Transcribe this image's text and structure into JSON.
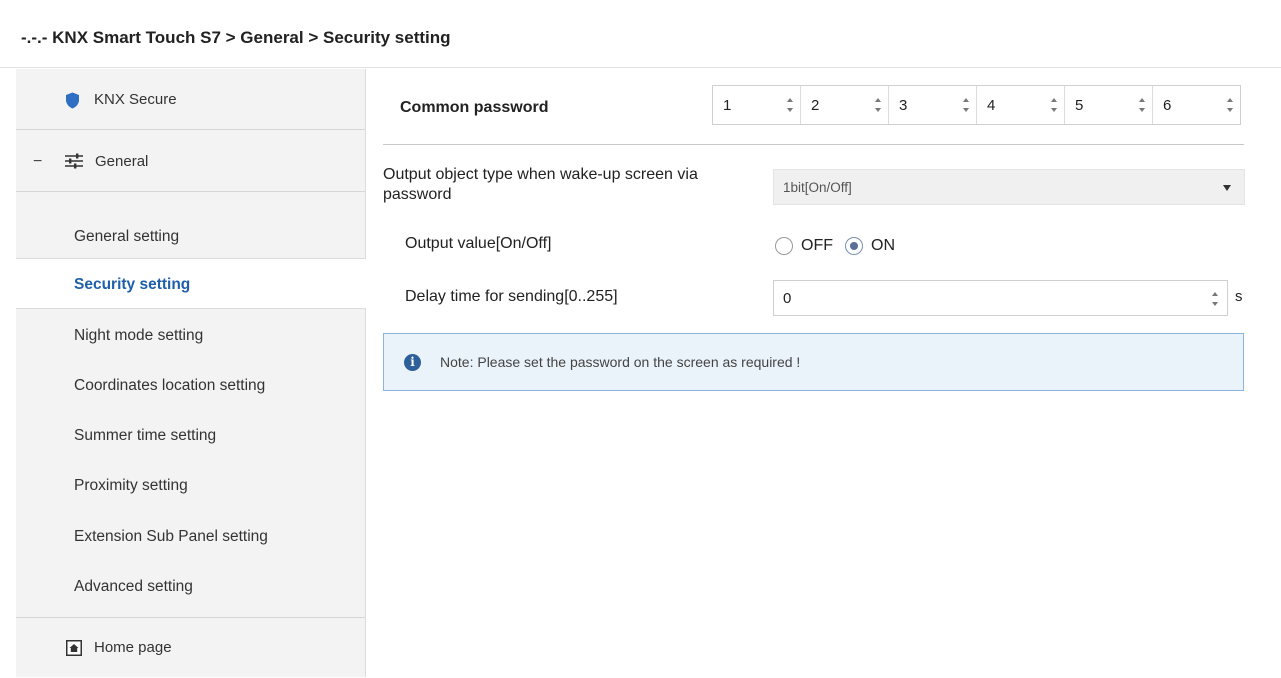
{
  "window": {
    "title": "-.-.- KNX Smart Touch S7 > General > Security setting"
  },
  "sidebar": {
    "knx_secure": "KNX Secure",
    "general": {
      "collapse_symbol": "−",
      "label": "General"
    },
    "items": [
      {
        "label": "General setting",
        "active": false
      },
      {
        "label": "Security setting",
        "active": true
      },
      {
        "label": "Night mode setting",
        "active": false
      },
      {
        "label": "Coordinates location setting",
        "active": false
      },
      {
        "label": "Summer time setting",
        "active": false
      },
      {
        "label": "Proximity setting",
        "active": false
      },
      {
        "label": "Extension Sub Panel setting",
        "active": false
      },
      {
        "label": "Advanced setting",
        "active": false
      }
    ],
    "home_page": "Home page"
  },
  "main": {
    "common_password": {
      "label": "Common password",
      "digits": [
        "1",
        "2",
        "3",
        "4",
        "5",
        "6"
      ]
    },
    "output_object_type": {
      "label": "Output object type when wake-up screen via password",
      "value": "1bit[On/Off]"
    },
    "output_value": {
      "label": "Output value[On/Off]",
      "options": [
        "OFF",
        "ON"
      ],
      "selected": "ON"
    },
    "delay_time": {
      "label": "Delay time for sending[0..255]",
      "value": "0",
      "unit": "s"
    },
    "note": {
      "icon": "i",
      "text": "Note: Please set the password on the screen as required !"
    }
  },
  "colors": {
    "accent": "#1f5fa9",
    "shield": "#2e6fc4",
    "note_bg": "#eaf2fa",
    "note_border": "#8db3d9",
    "sidebar_bg": "#f3f3f3"
  }
}
